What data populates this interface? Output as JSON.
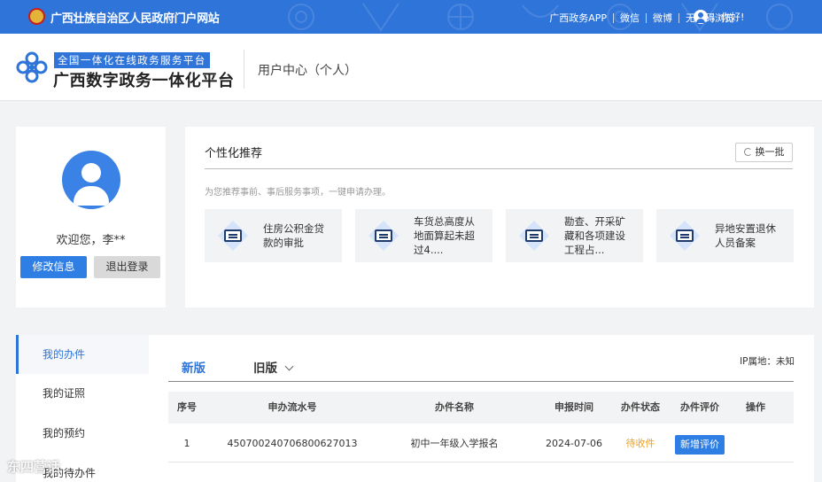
{
  "topbar": {
    "site_title": "广西壮族自治区人民政府门户网站",
    "links": [
      "广西政务APP",
      "微信",
      "微博",
      "无障碍浏览"
    ],
    "greeting": "，你好!",
    "bg_color": "#2f74d9"
  },
  "header": {
    "logo_top": "全国一体化在线政务服务平台",
    "logo_main": "广西数字政务一体化平台",
    "user_center": "用户中心（个人）"
  },
  "profile": {
    "welcome": "欢迎您，李**",
    "edit_label": "修改信息",
    "logout_label": "退出登录"
  },
  "recommend": {
    "title": "个性化推荐",
    "refresh_label": "换一批",
    "subtitle": "为您推荐事前、事后服务事项，一键申请办理。",
    "items": [
      {
        "text": "住房公积金贷款的审批",
        "icon": "id-card-icon"
      },
      {
        "text": "车货总高度从地面算起未超过4....",
        "icon": "id-card-icon"
      },
      {
        "text": "勘查、开采矿藏和各项建设工程占...",
        "icon": "id-card-icon"
      },
      {
        "text": "异地安置退休人员备案",
        "icon": "id-card-icon"
      }
    ]
  },
  "nav": {
    "items": [
      "我的办件",
      "我的证照",
      "我的预约",
      "我的待办件"
    ],
    "active_index": 0
  },
  "main": {
    "tab_new": "新版",
    "tab_old": "旧版",
    "ip_label": "IP属地：未知",
    "columns": [
      "序号",
      "申办流水号",
      "办件名称",
      "申报时间",
      "办件状态",
      "办件评价",
      "操作"
    ],
    "rows": [
      {
        "index": "1",
        "serial": "450700240706800627013",
        "name": "初中一年级入学报名",
        "date": "2024-07-06",
        "status": "待收件",
        "evaluate": "新增评价",
        "action": ""
      }
    ]
  },
  "watermark": "东四营话"
}
